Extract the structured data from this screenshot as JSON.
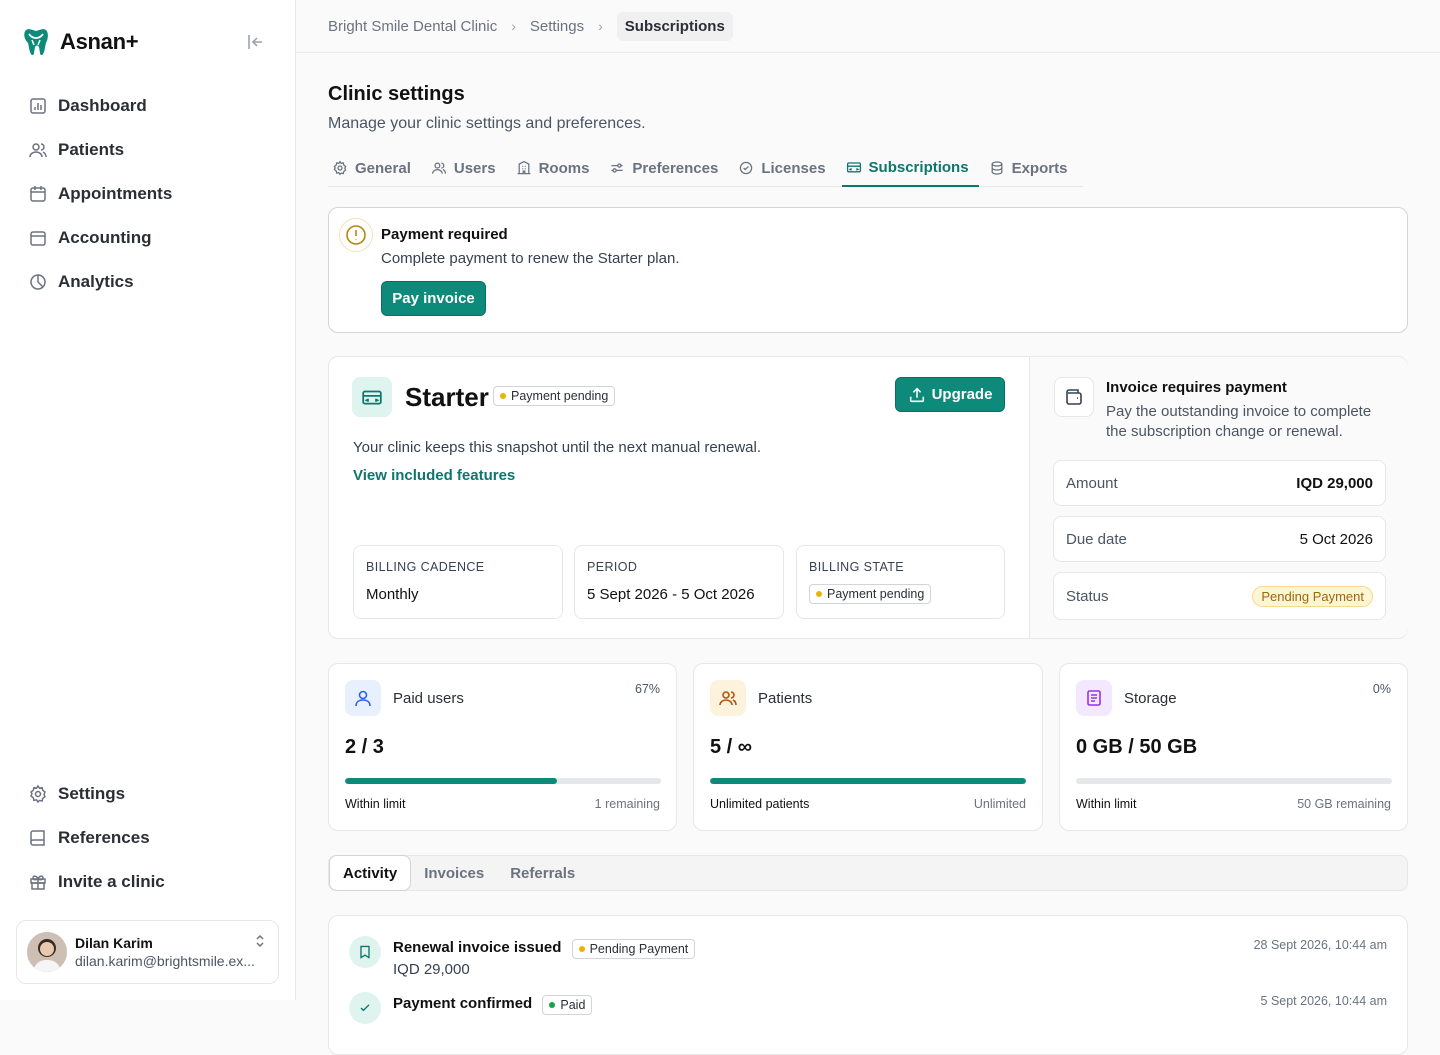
{
  "app": {
    "name": "Asnan+"
  },
  "sidebar": {
    "items": [
      {
        "label": "Dashboard",
        "icon": "chart-icon"
      },
      {
        "label": "Patients",
        "icon": "users-icon"
      },
      {
        "label": "Appointments",
        "icon": "calendar-icon"
      },
      {
        "label": "Accounting",
        "icon": "wallet-icon"
      },
      {
        "label": "Analytics",
        "icon": "pie-icon"
      }
    ],
    "bottom_items": [
      {
        "label": "Settings",
        "icon": "gear-icon"
      },
      {
        "label": "References",
        "icon": "book-icon"
      },
      {
        "label": "Invite a clinic",
        "icon": "gift-icon"
      }
    ],
    "user": {
      "name": "Dilan Karim",
      "email": "dilan.karim@brightsmile.ex..."
    }
  },
  "breadcrumb": [
    "Bright Smile Dental Clinic",
    "Settings",
    "Subscriptions"
  ],
  "page": {
    "title": "Clinic settings",
    "subtitle": "Manage your clinic settings and preferences."
  },
  "tabs": [
    {
      "label": "General",
      "icon": "gear-icon"
    },
    {
      "label": "Users",
      "icon": "users-icon"
    },
    {
      "label": "Rooms",
      "icon": "building-icon"
    },
    {
      "label": "Preferences",
      "icon": "sliders-icon"
    },
    {
      "label": "Licenses",
      "icon": "check-circle-icon"
    },
    {
      "label": "Subscriptions",
      "icon": "ticket-icon",
      "active": true
    },
    {
      "label": "Exports",
      "icon": "database-icon"
    }
  ],
  "alert": {
    "title": "Payment required",
    "description": "Complete payment to renew the Starter plan.",
    "button": "Pay invoice"
  },
  "plan": {
    "name": "Starter",
    "badge": "Payment pending",
    "upgrade": "Upgrade",
    "description": "Your clinic keeps this snapshot until the next manual renewal.",
    "link": "View included features",
    "meta": [
      {
        "label": "BILLING CADENCE",
        "value": "Monthly"
      },
      {
        "label": "PERIOD",
        "value": "5 Sept 2026 - 5 Oct 2026"
      },
      {
        "label": "BILLING STATE",
        "value": "Payment pending"
      }
    ]
  },
  "invoice": {
    "title": "Invoice requires payment",
    "description": "Pay the outstanding invoice to complete the subscription change or renewal.",
    "rows": [
      {
        "label": "Amount",
        "value": "IQD 29,000"
      },
      {
        "label": "Due date",
        "value": "5 Oct 2026"
      },
      {
        "label": "Status",
        "value": "Pending Payment"
      }
    ]
  },
  "usage": [
    {
      "title": "Paid users",
      "percent": "67%",
      "value": "2 / 3",
      "fill": 0.67,
      "left": "Within limit",
      "right": "1 remaining",
      "color": "#2563eb",
      "bg": "#e8effd"
    },
    {
      "title": "Patients",
      "percent": "",
      "value": "5 / ∞",
      "fill": 1.0,
      "left": "Unlimited patients",
      "right": "Unlimited",
      "color": "#b45309",
      "bg": "#fdf3dc"
    },
    {
      "title": "Storage",
      "percent": "0%",
      "value": "0 GB / 50 GB",
      "fill": 0,
      "left": "Within limit",
      "right": "50 GB remaining",
      "color": "#9333ea",
      "bg": "#f3e8fd"
    }
  ],
  "subtabs": [
    "Activity",
    "Invoices",
    "Referrals"
  ],
  "activity": [
    {
      "title": "Renewal invoice issued",
      "badge": "Pending Payment",
      "detail": "IQD 29,000",
      "time": "28 Sept 2026, 10:44 am"
    },
    {
      "title": "Payment confirmed",
      "badge": "Paid",
      "detail": "",
      "time": "5 Sept 2026, 10:44 am"
    }
  ]
}
